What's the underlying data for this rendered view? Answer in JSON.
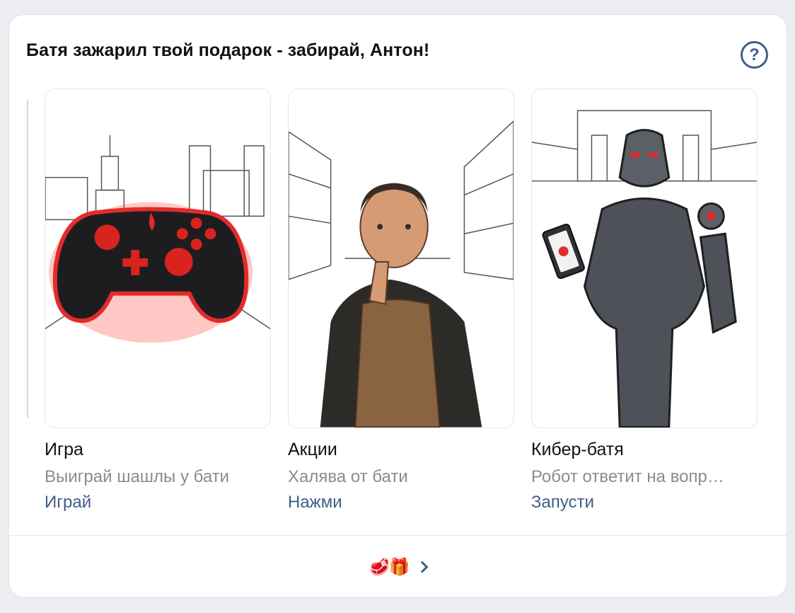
{
  "header": {
    "title": "Батя зажарил твой подарок - забирай, Антон!",
    "help_label": "?"
  },
  "cards": [
    {
      "name": "Игра",
      "description": "Выиграй шашлы у бати",
      "action": "Играй",
      "image": "red-gamepad-icon"
    },
    {
      "name": "Акции",
      "description": "Халява от бати",
      "action": "Нажми",
      "image": "man-in-apron"
    },
    {
      "name": "Кибер-батя",
      "description": "Робот ответит на вопр…",
      "action": "Запусти",
      "image": "robot-with-tablet"
    }
  ],
  "footer": {
    "emoji": "🥩🎁",
    "chevron": "chevron-right-icon"
  },
  "colors": {
    "background": "#ebedf0",
    "card": "#ffffff",
    "link": "#3f5f86",
    "secondary_text": "#878c93",
    "accent_red": "#e32b2b"
  }
}
